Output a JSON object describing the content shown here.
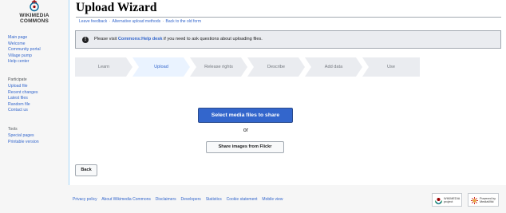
{
  "sidebar": {
    "logo": {
      "line1": "WIKIMEDIA",
      "line2": "COMMONS"
    },
    "main_links": [
      "Main page",
      "Welcome",
      "Community portal",
      "Village pump",
      "Help center"
    ],
    "participate": {
      "heading": "Participate",
      "links": [
        "Upload file",
        "Recent changes",
        "Latest files",
        "Random file",
        "Contact us"
      ]
    },
    "tools": {
      "heading": "Tools",
      "links": [
        "Special pages",
        "Printable version"
      ]
    }
  },
  "page": {
    "title": "Upload Wizard",
    "subnav": [
      "Leave feedback",
      "Alternative upload methods",
      "Back to the old form"
    ],
    "subnav_separator": "·"
  },
  "notice": {
    "icon": "!",
    "text_before": "Please visit ",
    "link": "Commons:Help desk",
    "text_after": " if you need to ask questions about uploading files."
  },
  "steps": {
    "items": [
      "Learn",
      "Upload",
      "Release rights",
      "Describe",
      "Add data",
      "Use"
    ],
    "active_index": 1
  },
  "actions": {
    "select_files": "Select media files to share",
    "or": "or",
    "flickr": "Share images from Flickr",
    "back": "Back"
  },
  "footer": {
    "links": [
      "Privacy policy",
      "About Wikimedia Commons",
      "Disclaimers",
      "Developers",
      "Statistics",
      "Cookie statement",
      "Mobile view"
    ],
    "badges": [
      {
        "line1": "WIKIMEDIA",
        "line2": "project"
      },
      {
        "line1": "Powered by",
        "line2": "MediaWiki"
      }
    ]
  },
  "colors": {
    "link": "#3366cc",
    "progressive": "#3366cc",
    "step_active_bg": "#eaf3ff",
    "step_inactive_bg": "#eaecf0"
  }
}
